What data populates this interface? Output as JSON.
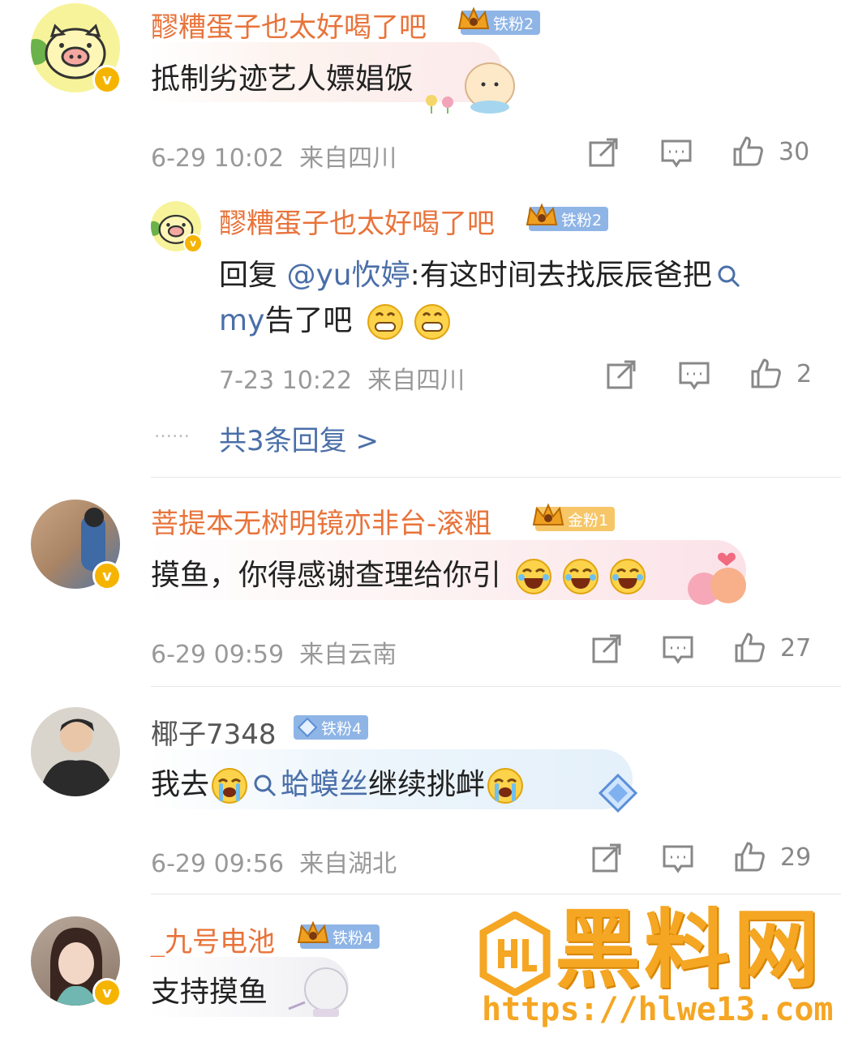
{
  "comments": [
    {
      "name": "醪糟蛋子也太好喝了吧",
      "fan_badge": "铁粉2",
      "text": "抵制劣迹艺人嫖娼饭",
      "time": "6-29 10:02",
      "location": "来自四川",
      "likes": "30"
    },
    {
      "name": "菩提本无树明镜亦非台-滚粗",
      "fan_badge": "金粉1",
      "text": "摸鱼，你得感谢查理给你引",
      "time": "6-29 09:59",
      "location": "来自云南",
      "likes": "27"
    },
    {
      "name": "椰子7348",
      "fan_badge": "铁粉4",
      "text_prefix": "我去",
      "text_search": "蛤蟆丝",
      "text_suffix": "继续挑衅",
      "time": "6-29 09:56",
      "location": "来自湖北",
      "likes": "29"
    },
    {
      "name": "_九号电池",
      "fan_badge": "铁粉4",
      "text": "支持摸鱼"
    }
  ],
  "reply": {
    "name": "醪糟蛋子也太好喝了吧",
    "fan_badge": "铁粉2",
    "reply_prefix": "回复 ",
    "mention": "@yu忺婷",
    "text_line1": ":有这时间去找辰辰爸把",
    "text_search": "my",
    "text_line2": "告了吧",
    "time": "7-23 10:22",
    "location": "来自四川",
    "likes": "2"
  },
  "more_replies": {
    "dots": "……",
    "label": "共3条回复 >"
  },
  "watermark": {
    "logo_text": "黑料网",
    "url": "https://hlwe13.com"
  },
  "colors": {
    "username": "#e8733a",
    "mention": "#4a6fa8",
    "meta": "#999999",
    "verified": "#f5b400"
  },
  "icons": [
    "share-icon",
    "comment-icon",
    "like-icon",
    "search-icon",
    "verified-icon",
    "crown-icon",
    "diamond-icon"
  ]
}
